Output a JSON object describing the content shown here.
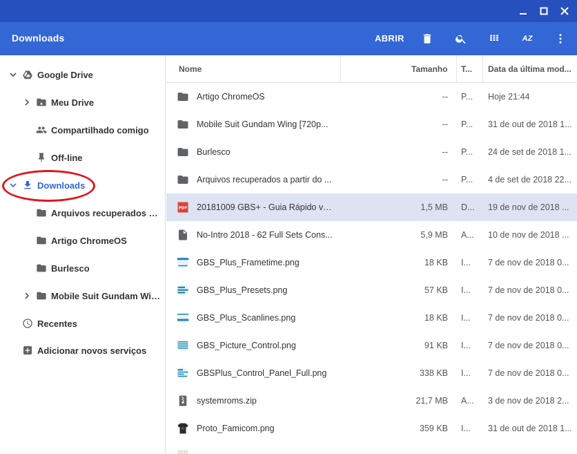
{
  "titlebar": {
    "minimize_icon": "minimize-icon",
    "maximize_icon": "maximize-icon",
    "close_icon": "close-icon"
  },
  "header": {
    "title": "Downloads",
    "open_label": "ABRIR",
    "az_label": "AZ"
  },
  "sidebar": {
    "google_drive": "Google Drive",
    "meu_drive": "Meu Drive",
    "shared": "Compartilhado comigo",
    "offline": "Off-line",
    "downloads": "Downloads",
    "sub1": "Arquivos recuperados a p...",
    "sub2": "Artigo ChromeOS",
    "sub3": "Burlesco",
    "sub4": "Mobile Suit Gundam Wing ...",
    "recent": "Recentes",
    "add_services": "Adicionar novos serviços"
  },
  "columns": {
    "name": "Nome",
    "size": "Tamanho",
    "type": "T...",
    "date": "Data da última mod..."
  },
  "files": [
    {
      "name": "Artigo ChromeOS",
      "size": "--",
      "type": "P...",
      "date": "Hoje 21:44"
    },
    {
      "name": "Mobile Suit Gundam Wing [720p...",
      "size": "--",
      "type": "P...",
      "date": "31 de out de 2018 1..."
    },
    {
      "name": "Burlesco",
      "size": "--",
      "type": "P...",
      "date": "24 de set de 2018 1..."
    },
    {
      "name": "Arquivos recuperados a partir do ...",
      "size": "--",
      "type": "P...",
      "date": "4 de set de 2018 22..."
    },
    {
      "name": "20181009 GBS+ - Guia Rápido v1...",
      "size": "1,5 MB",
      "type": "D...",
      "date": "19 de nov de 2018 ..."
    },
    {
      "name": "No-Intro 2018 - 62 Full Sets Cons...",
      "size": "5,9 MB",
      "type": "A...",
      "date": "10 de nov de 2018 ..."
    },
    {
      "name": "GBS_Plus_Frametime.png",
      "size": "18 KB",
      "type": "I...",
      "date": "7 de nov de 2018 0..."
    },
    {
      "name": "GBS_Plus_Presets.png",
      "size": "57 KB",
      "type": "I...",
      "date": "7 de nov de 2018 0..."
    },
    {
      "name": "GBS_Plus_Scanlines.png",
      "size": "18 KB",
      "type": "I...",
      "date": "7 de nov de 2018 0..."
    },
    {
      "name": "GBS_Picture_Control.png",
      "size": "91 KB",
      "type": "I...",
      "date": "7 de nov de 2018 0..."
    },
    {
      "name": "GBSPlus_Control_Panel_Full.png",
      "size": "338 KB",
      "type": "I...",
      "date": "7 de nov de 2018 0..."
    },
    {
      "name": "systemroms.zip",
      "size": "21,7 MB",
      "type": "A...",
      "date": "3 de nov de 2018 2..."
    },
    {
      "name": "Proto_Famicom.png",
      "size": "359 KB",
      "type": "I...",
      "date": "31 de out de 2018 1..."
    }
  ],
  "colors": {
    "titlebar": "#2650bd",
    "header": "#3367d6",
    "selection": "#dde3f3",
    "annotation": "#e0161c"
  }
}
